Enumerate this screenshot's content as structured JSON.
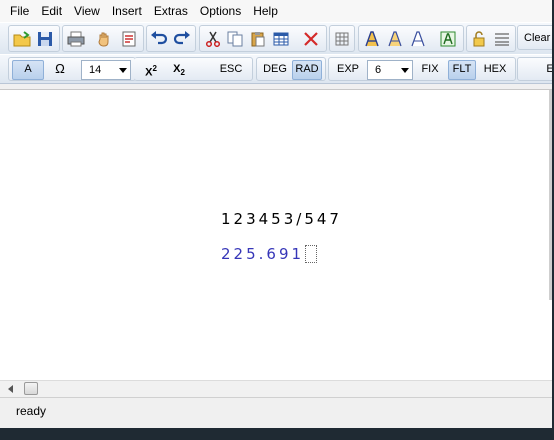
{
  "menu": [
    "File",
    "Edit",
    "View",
    "Insert",
    "Extras",
    "Options",
    "Help"
  ],
  "toolbar1": {
    "icons": {
      "open": "open-folder-icon",
      "save": "save-icon",
      "print": "print-icon",
      "hand": "hand-icon",
      "properties": "document-properties-icon",
      "undo": "undo-icon",
      "redo": "redo-icon",
      "cut": "cut-icon",
      "copy": "copy-icon",
      "paste": "paste-icon",
      "table": "table-icon",
      "delete": "delete-x-icon",
      "grid": "grid-icon",
      "font_a1": "font-a-icon",
      "font_a2": "font-a-icon",
      "font_a3": "font-a-icon",
      "font_a_green": "font-a-box-icon",
      "lock": "lock-icon",
      "lines": "lines-icon"
    },
    "clear_label": "Clear"
  },
  "toolbar2": {
    "font_a_label": "A",
    "omega_label": "Ω",
    "font_size": "14",
    "superscript_label": "X",
    "superscript_mark": "2",
    "subscript_label": "X",
    "subscript_mark": "2",
    "esc_label": "ESC",
    "deg_label": "DEG",
    "rad_label": "RAD",
    "exp_label": "EXP",
    "precision": "6",
    "fix_label": "FIX",
    "flt_label": "FLT",
    "hex_label": "HEX",
    "e_label": "E"
  },
  "document": {
    "expression": "123453/547",
    "result": "225.691"
  },
  "status": {
    "text": "ready"
  },
  "colors": {
    "result": "#3636b8",
    "active_toggle": "#b9d0ec"
  }
}
